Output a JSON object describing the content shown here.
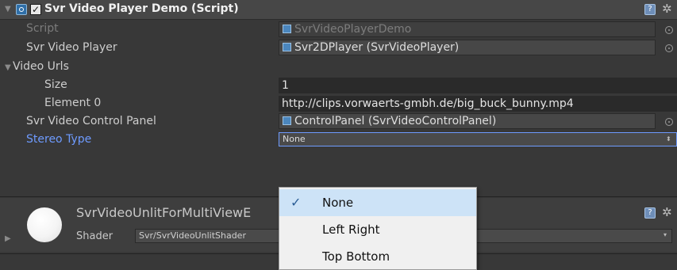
{
  "component": {
    "fold_glyph": "▼",
    "enabled_check": "✓",
    "title": "Svr Video Player Demo (Script)",
    "help_glyph": "?",
    "gear_glyph": "✲"
  },
  "fields": {
    "script": {
      "label": "Script",
      "value": "SvrVideoPlayerDemo"
    },
    "player": {
      "label": "Svr Video Player",
      "value": "Svr2DPlayer (SvrVideoPlayer)"
    },
    "urls": {
      "fold_glyph": "▼",
      "label": "Video Urls"
    },
    "size": {
      "label": "Size",
      "value": "1"
    },
    "element0": {
      "label": "Element 0",
      "value": "http://clips.vorwaerts-gmbh.de/big_buck_bunny.mp4"
    },
    "control_panel": {
      "label": "Svr Video Control Panel",
      "value": "ControlPanel (SvrVideoControlPanel)"
    },
    "stereo": {
      "label": "Stereo Type",
      "value": "None",
      "arrows": "⬍"
    }
  },
  "material": {
    "name": "SvrVideoUnlitForMultiViewE",
    "shader_label": "Shader",
    "shader_value": "Svr/SvrVideoUnlitShader",
    "fold_glyph": "▶",
    "dropdown_glyph": "▾",
    "help_glyph": "?",
    "gear_glyph": "✲"
  },
  "stereo_menu": {
    "check_glyph": "✓",
    "options": [
      {
        "label": "None",
        "selected": true
      },
      {
        "label": "Left Right",
        "selected": false
      },
      {
        "label": "Top Bottom",
        "selected": false
      }
    ]
  },
  "colors": {
    "panel_bg": "#383838",
    "header_bg": "#474747",
    "label_text": "#cdcdcd",
    "highlight_label": "#6e9bff",
    "menu_bg": "#f0f0f0",
    "menu_selected": "#cde3f7"
  }
}
